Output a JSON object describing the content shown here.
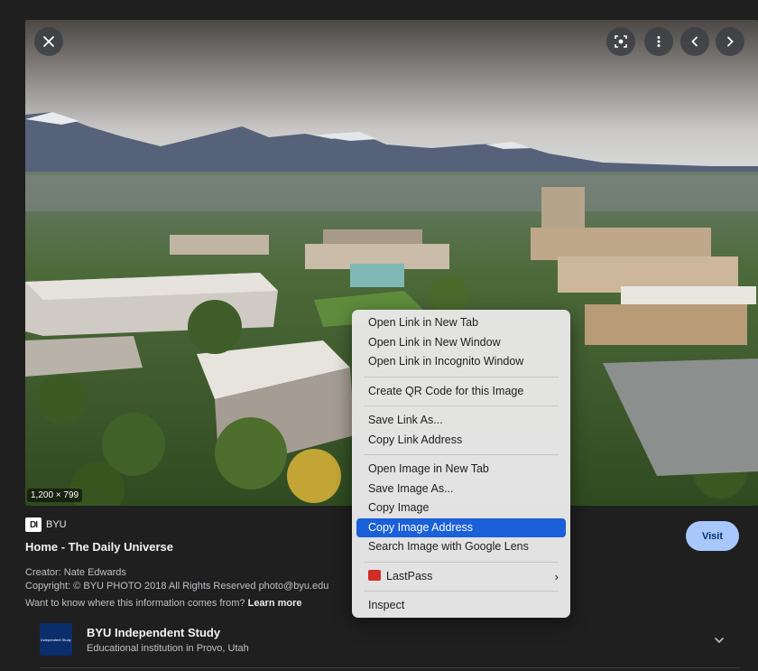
{
  "viewer": {
    "image_dimensions": "1,200 × 799",
    "icons": {
      "close": "close-icon",
      "lens": "lens-icon",
      "more": "more-vert-icon",
      "prev": "chevron-left-icon",
      "next": "chevron-right-icon"
    }
  },
  "result": {
    "source_logo_text": "DI",
    "source_name": "BYU",
    "title": "Home - The Daily Universe",
    "visit_label": "Visit",
    "creator": "Creator: Nate Edwards",
    "copyright": "Copyright: © BYU PHOTO 2018 All Rights Reserved photo@byu.edu",
    "info_question": "Want to know where this information comes from?",
    "learn_more": "Learn more"
  },
  "knowledge": {
    "thumb_text": "Independent Study",
    "title": "BYU Independent Study",
    "subtitle": "Educational institution in Provo, Utah"
  },
  "context_menu": {
    "groups": [
      [
        "Open Link in New Tab",
        "Open Link in New Window",
        "Open Link in Incognito Window"
      ],
      [
        "Create QR Code for this Image"
      ],
      [
        "Save Link As...",
        "Copy Link Address"
      ],
      [
        "Open Image in New Tab",
        "Save Image As...",
        "Copy Image",
        "Copy Image Address",
        "Search Image with Google Lens"
      ],
      [
        "LastPass"
      ],
      [
        "Inspect"
      ]
    ],
    "highlighted": "Copy Image Address",
    "accent_color": "#1a60d8"
  },
  "colors": {
    "background": "#1f1f1f",
    "visit_button": "#a8c7fa"
  }
}
